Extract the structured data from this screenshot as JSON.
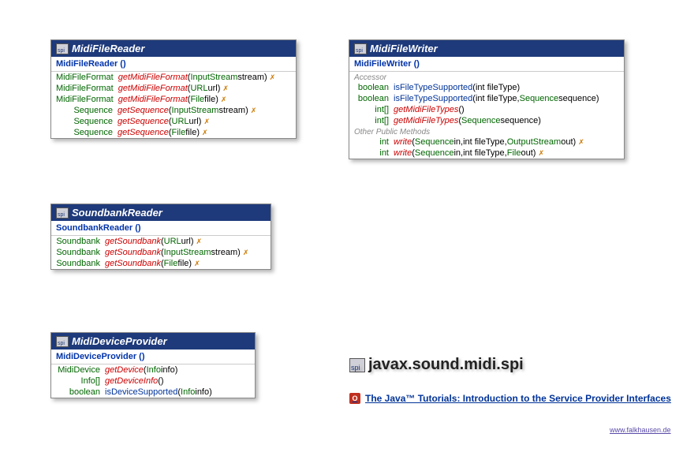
{
  "package_name": "javax.sound.midi.spi",
  "spi_badge": "spi",
  "tutorial": "The Java™ Tutorials: Introduction to the Service Provider Interfaces",
  "footer": "www.falkhausen.de",
  "classes": {
    "mfr": {
      "title": "MidiFileReader",
      "constructor": "MidiFileReader ()",
      "methods": [
        {
          "ret": "MidiFileFormat",
          "name": "getMidiFileFormat",
          "params": [
            [
              "InputStream",
              "stream"
            ]
          ],
          "italic": true,
          "throws": true
        },
        {
          "ret": "MidiFileFormat",
          "name": "getMidiFileFormat",
          "params": [
            [
              "URL",
              "url"
            ]
          ],
          "italic": true,
          "throws": true
        },
        {
          "ret": "MidiFileFormat",
          "name": "getMidiFileFormat",
          "params": [
            [
              "File",
              "file"
            ]
          ],
          "italic": true,
          "throws": true
        },
        {
          "ret": "Sequence",
          "name": "getSequence",
          "params": [
            [
              "InputStream",
              "stream"
            ]
          ],
          "italic": true,
          "throws": true
        },
        {
          "ret": "Sequence",
          "name": "getSequence",
          "params": [
            [
              "URL",
              "url"
            ]
          ],
          "italic": true,
          "throws": true
        },
        {
          "ret": "Sequence",
          "name": "getSequence",
          "params": [
            [
              "File",
              "file"
            ]
          ],
          "italic": true,
          "throws": true
        }
      ]
    },
    "mfw": {
      "title": "MidiFileWriter",
      "constructor": "MidiFileWriter ()",
      "section1": "Accessor",
      "methods1": [
        {
          "ret": "boolean",
          "name": "isFileTypeSupported",
          "params": [
            [
              "int",
              "fileType"
            ]
          ],
          "italic": false
        },
        {
          "ret": "boolean",
          "name": "isFileTypeSupported",
          "params": [
            [
              "int",
              "fileType"
            ],
            [
              "Sequence",
              "sequence"
            ]
          ],
          "italic": false
        },
        {
          "ret": "int[]",
          "name": "getMidiFileTypes",
          "params": [],
          "italic": true
        },
        {
          "ret": "int[]",
          "name": "getMidiFileTypes",
          "params": [
            [
              "Sequence",
              "sequence"
            ]
          ],
          "italic": true
        }
      ],
      "section2": "Other Public Methods",
      "methods2": [
        {
          "ret": "int",
          "name": "write",
          "params": [
            [
              "Sequence",
              "in"
            ],
            [
              "int",
              "fileType"
            ],
            [
              "OutputStream",
              "out"
            ]
          ],
          "italic": true,
          "throws": true
        },
        {
          "ret": "int",
          "name": "write",
          "params": [
            [
              "Sequence",
              "in"
            ],
            [
              "int",
              "fileType"
            ],
            [
              "File",
              "out"
            ]
          ],
          "italic": true,
          "throws": true
        }
      ]
    },
    "sbr": {
      "title": "SoundbankReader",
      "constructor": "SoundbankReader ()",
      "methods": [
        {
          "ret": "Soundbank",
          "name": "getSoundbank",
          "params": [
            [
              "URL",
              "url"
            ]
          ],
          "italic": true,
          "throws": true
        },
        {
          "ret": "Soundbank",
          "name": "getSoundbank",
          "params": [
            [
              "InputStream",
              "stream"
            ]
          ],
          "italic": true,
          "throws": true
        },
        {
          "ret": "Soundbank",
          "name": "getSoundbank",
          "params": [
            [
              "File",
              "file"
            ]
          ],
          "italic": true,
          "throws": true
        }
      ]
    },
    "mdp": {
      "title": "MidiDeviceProvider",
      "constructor": "MidiDeviceProvider ()",
      "methods": [
        {
          "ret": "MidiDevice",
          "name": "getDevice",
          "params": [
            [
              "Info",
              "info"
            ]
          ],
          "italic": true
        },
        {
          "ret": "Info[]",
          "name": "getDeviceInfo",
          "params": [],
          "italic": true
        },
        {
          "ret": "boolean",
          "name": "isDeviceSupported",
          "params": [
            [
              "Info",
              "info"
            ]
          ],
          "italic": false
        }
      ]
    }
  }
}
